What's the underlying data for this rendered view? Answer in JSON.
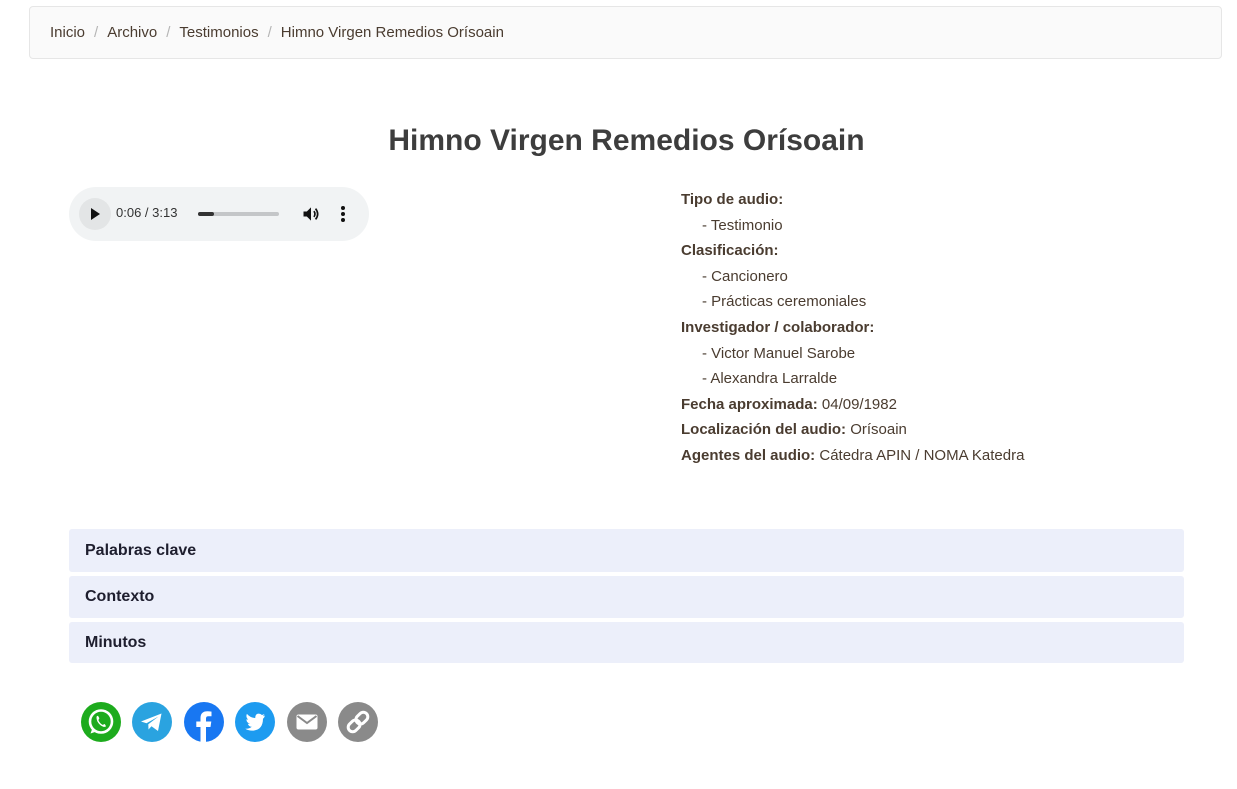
{
  "breadcrumb": {
    "home": "Inicio",
    "archive": "Archivo",
    "testimonies": "Testimonios",
    "current": "Himno Virgen Remedios Orísoain",
    "separator": "/"
  },
  "title": "Himno Virgen Remedios Orísoain",
  "audio": {
    "current_time": "0:06",
    "duration": "3:13",
    "time_label": "0:06 / 3:13",
    "progress_fraction": 0.031
  },
  "metadata": {
    "audio_type_label": "Tipo de audio:",
    "audio_type_items": [
      "- Testimonio"
    ],
    "classification_label": "Clasificación:",
    "classification_items": [
      "- Cancionero",
      "- Prácticas ceremoniales"
    ],
    "researcher_label": "Investigador / colaborador:",
    "researcher_items": [
      "- Victor Manuel Sarobe",
      "- Alexandra Larralde"
    ],
    "date_label": "Fecha aproximada:",
    "date_value": "04/09/1982",
    "location_label": "Localización del audio:",
    "location_value": "Orísoain",
    "agents_label": "Agentes del audio:",
    "agents_value": "Cátedra APIN / NOMA Katedra"
  },
  "accordion": {
    "keywords": "Palabras clave",
    "context": "Contexto",
    "minutes": "Minutos"
  },
  "share": {
    "icons": [
      "whatsapp-icon",
      "telegram-icon",
      "facebook-icon",
      "twitter-icon",
      "email-icon",
      "link-icon"
    ],
    "colors": {
      "whatsapp": "#1dab1d",
      "telegram": "#2aa3e0",
      "facebook": "#1877f2",
      "twitter": "#1d9bf0",
      "email": "#8a8a8a",
      "link": "#8a8a8a"
    }
  },
  "colors": {
    "accordion_bg": "#eceffa",
    "player_bg": "#f1f3f4",
    "breadcrumb_text": "#4a3c30"
  }
}
